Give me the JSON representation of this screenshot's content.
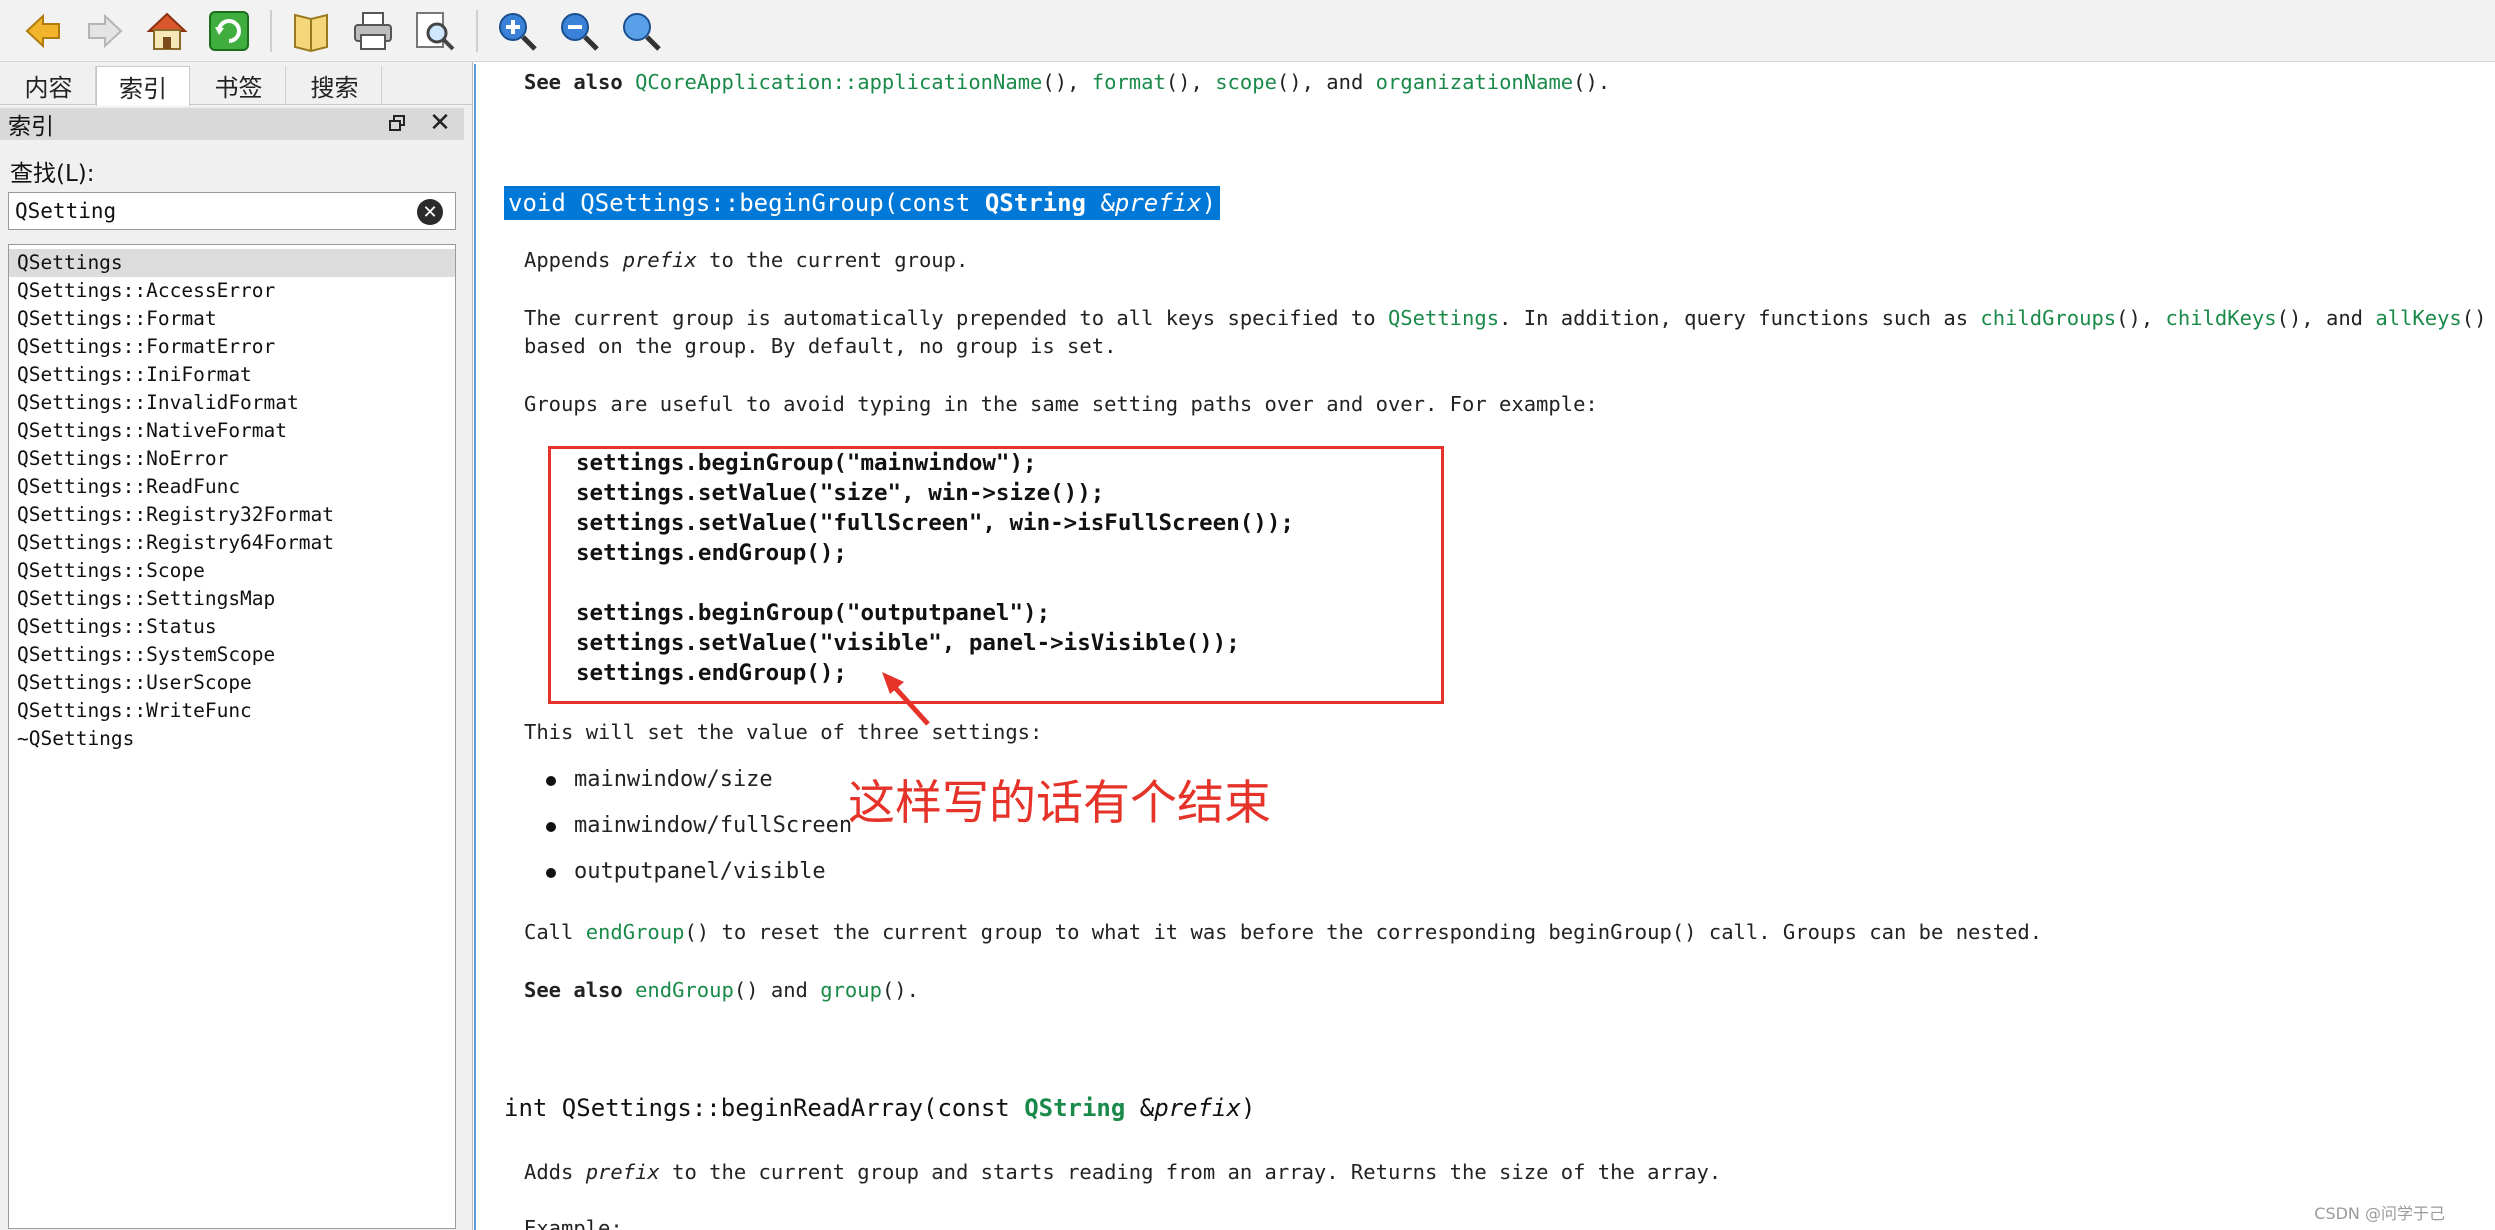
{
  "toolbar": {
    "buttons": [
      "back-icon",
      "forward-icon",
      "home-icon",
      "sync-icon",
      "open-bookmark-icon",
      "print-icon",
      "find-icon",
      "zoom-in-icon",
      "zoom-out-icon",
      "zoom-reset-icon"
    ]
  },
  "sidebar": {
    "tabs": [
      "内容",
      "索引",
      "书签",
      "搜索"
    ],
    "active_tab": "索引",
    "panel_title": "索引",
    "find_label": "查找(L):",
    "search_value": "QSetting",
    "items": [
      "QSettings",
      "QSettings::AccessError",
      "QSettings::Format",
      "QSettings::FormatError",
      "QSettings::IniFormat",
      "QSettings::InvalidFormat",
      "QSettings::NativeFormat",
      "QSettings::NoError",
      "QSettings::ReadFunc",
      "QSettings::Registry32Format",
      "QSettings::Registry64Format",
      "QSettings::Scope",
      "QSettings::SettingsMap",
      "QSettings::Status",
      "QSettings::SystemScope",
      "QSettings::UserScope",
      "QSettings::WriteFunc",
      "~QSettings"
    ]
  },
  "doc": {
    "see_also_1": {
      "pre": "See also ",
      "l1": "QCoreApplication::applicationName",
      "t1": "(), ",
      "l2": "format",
      "t2": "(), ",
      "l3": "scope",
      "t3": "(), and ",
      "l4": "organizationName",
      "t4": "()."
    },
    "heading1": {
      "ret": "void ",
      "name": "QSettings::beginGroup",
      "args": "(const ",
      "type": "QString",
      "amp": " &",
      "param": "prefix",
      "close": ")"
    },
    "append": {
      "pre": "Appends ",
      "param": "prefix",
      "post": " to the current group."
    },
    "current": {
      "pre": "The current group is automatically prepended to all keys specified to ",
      "l1": "QSettings",
      "t1": ". In addition, query functions such as ",
      "l2": "childGroups",
      "t2": "(), ",
      "l3": "childKeys",
      "t3": "(), and ",
      "l4": "allKeys",
      "t4": "() are",
      "line2": "based on the group. By default, no group is set."
    },
    "groups_useful": "Groups are useful to avoid typing in the same setting paths over and over. For example:",
    "code": [
      "settings.beginGroup(\"mainwindow\");",
      "settings.setValue(\"size\", win->size());",
      "settings.setValue(\"fullScreen\", win->isFullScreen());",
      "settings.endGroup();",
      "",
      "settings.beginGroup(\"outputpanel\");",
      "settings.setValue(\"visible\", panel->isVisible());",
      "settings.endGroup();"
    ],
    "three_settings": "This will set the value of three settings:",
    "bullets": [
      "mainwindow/size",
      "mainwindow/fullScreen",
      "outputpanel/visible"
    ],
    "annotation": "这样写的话有个结束",
    "call_end": {
      "pre": "Call ",
      "l1": "endGroup",
      "t1": "() to reset the current group to what it was before the corresponding beginGroup() call. Groups can be nested."
    },
    "see_also_2": {
      "pre": "See also ",
      "l1": "endGroup",
      "t1": "() and ",
      "l2": "group",
      "t2": "()."
    },
    "heading2": {
      "ret": "int ",
      "name": "QSettings::beginReadArray",
      "args": "(const ",
      "type": "QString",
      "amp": " &",
      "param": "prefix",
      "close": ")"
    },
    "adds": {
      "pre": "Adds ",
      "param": "prefix",
      "post": " to the current group and starts reading from an array. Returns the size of the array."
    },
    "example_cut": "Example:"
  },
  "watermark": "CSDN @问学于己",
  "colors": {
    "link": "#1a8a4a",
    "selection": "#0078d7",
    "annotation": "#e6332a"
  }
}
